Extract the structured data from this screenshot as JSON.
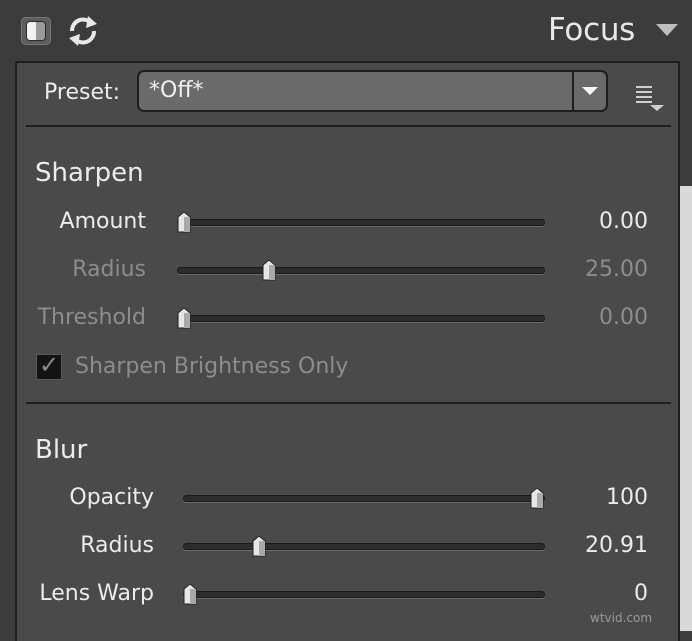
{
  "header": {
    "title": "Focus",
    "icons": [
      "compare-toggle-icon",
      "reset-icon",
      "panel-collapse-icon"
    ]
  },
  "preset": {
    "label": "Preset:",
    "value": "*Off*",
    "menu_icon": "preset-menu-icon"
  },
  "sharpen": {
    "title": "Sharpen",
    "sliders": [
      {
        "label": "Amount",
        "value": "0.00",
        "position": 0.0,
        "enabled": true
      },
      {
        "label": "Radius",
        "value": "25.00",
        "position": 0.25,
        "enabled": false
      },
      {
        "label": "Threshold",
        "value": "0.00",
        "position": 0.0,
        "enabled": false
      }
    ],
    "brightness_only": {
      "label": "Sharpen Brightness Only",
      "checked": true,
      "enabled": false
    }
  },
  "blur": {
    "title": "Blur",
    "sliders": [
      {
        "label": "Opacity",
        "value": "100",
        "position": 1.0,
        "enabled": true
      },
      {
        "label": "Radius",
        "value": "20.91",
        "position": 0.21,
        "enabled": true
      },
      {
        "label": "Lens Warp",
        "value": "0",
        "position": 0.0,
        "enabled": true
      }
    ]
  },
  "watermark": "wtvid.com",
  "colors": {
    "panel": "#4a4a4a",
    "header": "#3c3c3c",
    "track": "#2d2d2d",
    "text": "#ececec",
    "dim_text": "#8d8d8d"
  }
}
